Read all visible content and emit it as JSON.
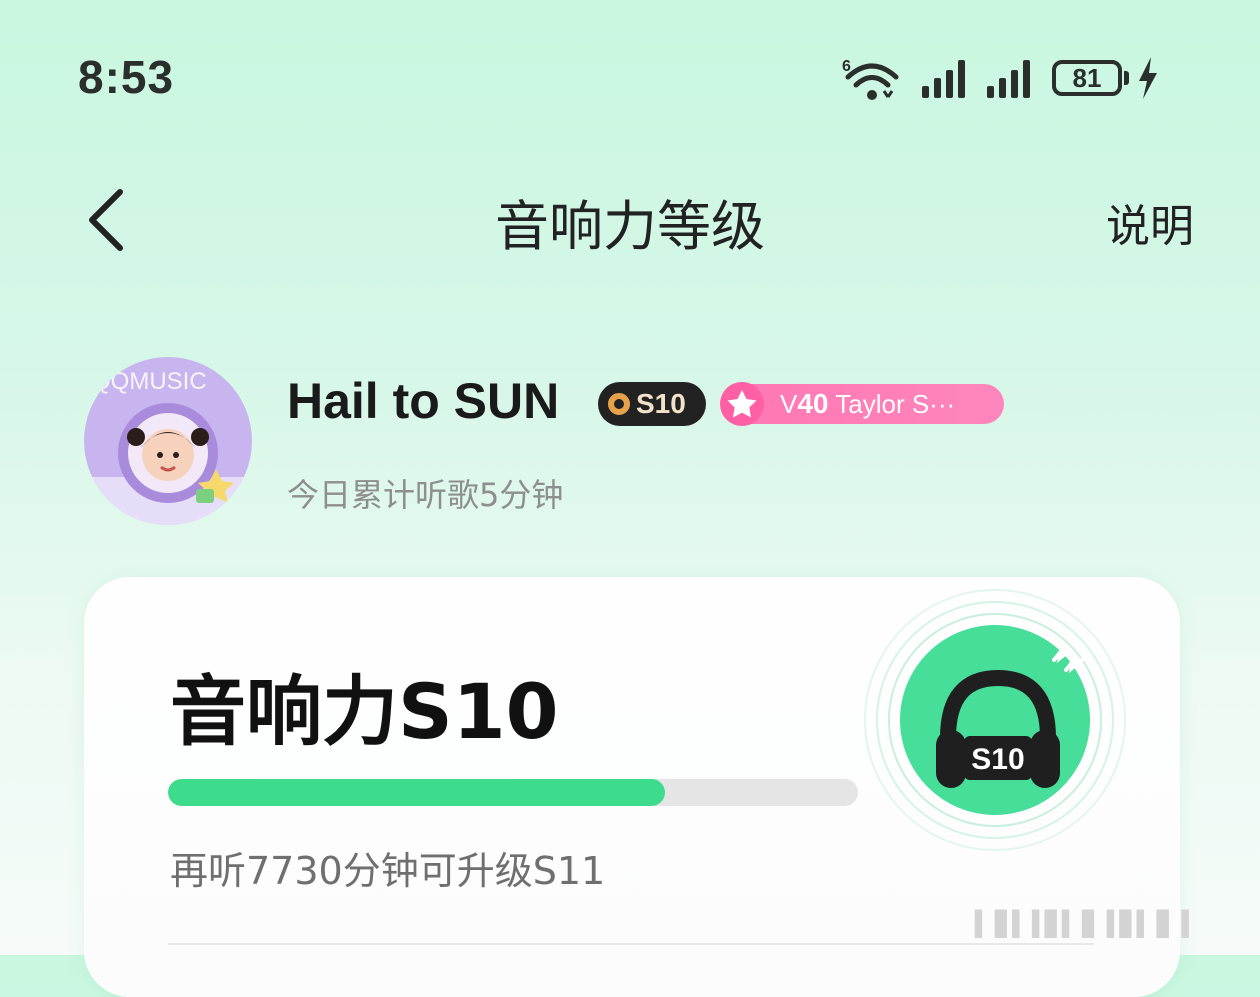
{
  "status_bar": {
    "time": "8:53",
    "wifi_badge": "6",
    "battery_level": "81",
    "icons": [
      "wifi-icon",
      "signal-icon",
      "signal-icon",
      "battery-icon",
      "charging-icon"
    ]
  },
  "header": {
    "title": "音响力等级",
    "help_label": "说明",
    "back_icon": "chevron-left-icon"
  },
  "profile": {
    "username": "Hail to SUN",
    "avatar_text": "QQMUSIC",
    "level_badge": "S10",
    "vip_level": "40",
    "vip_prefix": "V",
    "vip_label": "Taylor S···",
    "today_listening": "今日累计听歌5分钟"
  },
  "level_card": {
    "title": "音响力S10",
    "progress_fraction": 0.72,
    "upgrade_hint": "再听7730分钟可升级S11",
    "emblem_label": "S10"
  },
  "colors": {
    "accent_green": "#3ddc8d",
    "vip_pink": "#ff7fb8",
    "track_gray": "#e5e5e5"
  }
}
